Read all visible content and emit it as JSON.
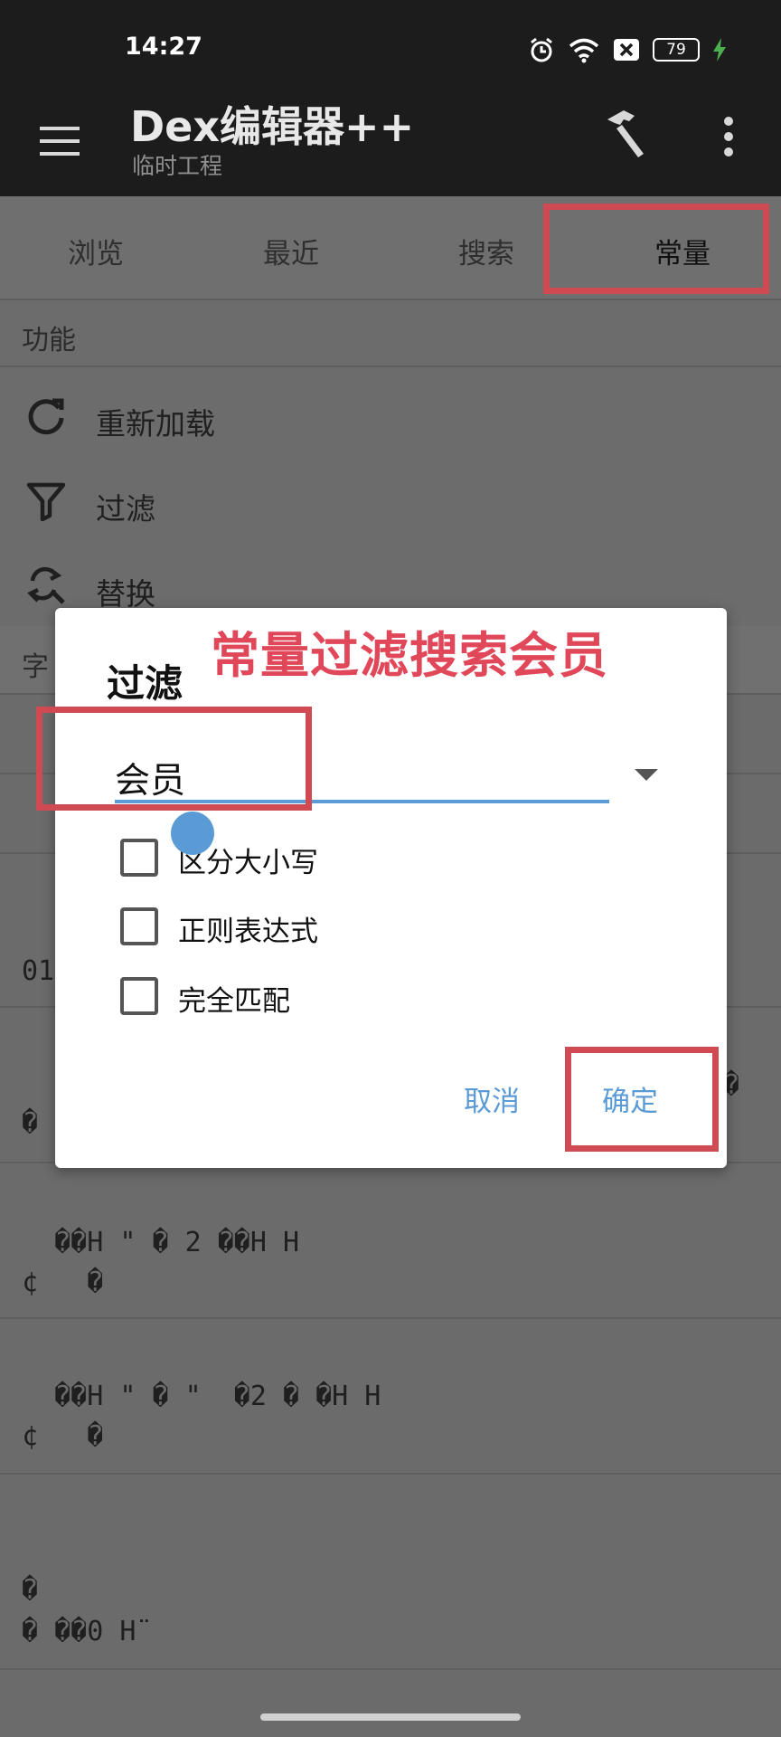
{
  "status_bar": {
    "time": "14:27",
    "battery": "79"
  },
  "app_bar": {
    "title": "Dex编辑器++",
    "subtitle": "临时工程"
  },
  "tabs": [
    "浏览",
    "最近",
    "搜索",
    "常量"
  ],
  "sections": {
    "functions": "功能",
    "strings_partial": "字"
  },
  "functions": [
    {
      "label": "重新加载",
      "icon": "refresh-icon"
    },
    {
      "label": "过滤",
      "icon": "filter-icon"
    },
    {
      "label": "替换",
      "icon": "replace-icon"
    }
  ],
  "background_rows": {
    "row_01": "01",
    "row_mark_a": "�",
    "row_mark_b": "�",
    "row4_line1": "  ��H \" � 2 ��H H",
    "row4_line2": "¢   �",
    "row5_line1": "  ��H \" � \"  �2 � �H H",
    "row5_line2": "¢   �",
    "row6_line1": "�",
    "row6_line2": "� ��0 H¨"
  },
  "annotation": "常量过滤搜索会员",
  "dialog": {
    "title": "过滤",
    "input_value": "会员",
    "options": [
      "区分大小写",
      "正则表达式",
      "完全匹配"
    ],
    "cancel_label": "取消",
    "ok_label": "确定"
  },
  "colors": {
    "accent": "#5b9bd5",
    "highlight": "#d04a54",
    "appbar": "#1c1c1c"
  }
}
